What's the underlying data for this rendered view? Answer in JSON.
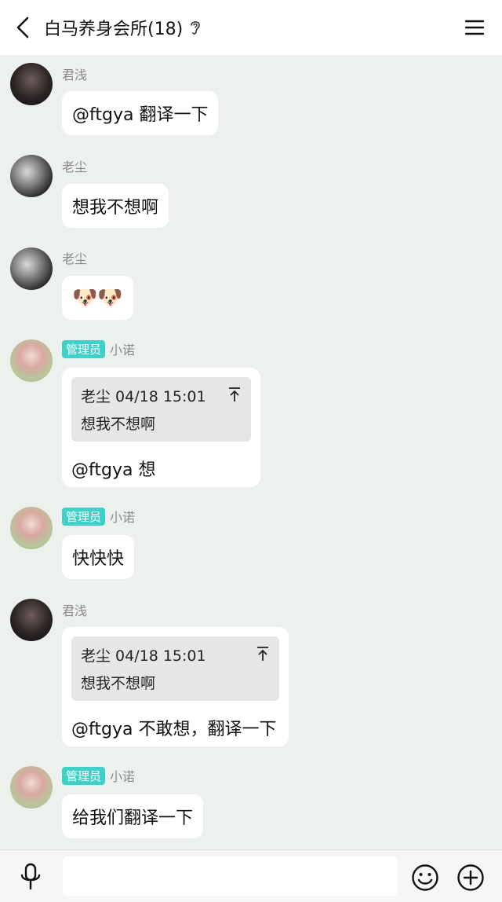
{
  "header": {
    "title": "白马养身会所(18)",
    "icons": [
      "back-icon",
      "ear-icon",
      "menu-icon"
    ]
  },
  "messages": [
    {
      "sender": "君浅",
      "is_admin": false,
      "text": "@ftgya 翻译一下"
    },
    {
      "sender": "老尘",
      "is_admin": false,
      "text": "想我不想啊"
    },
    {
      "sender": "老尘",
      "is_admin": false,
      "text": "🐶🐶"
    },
    {
      "sender": "小诺",
      "is_admin": true,
      "admin_label": "管理员",
      "quote": {
        "author_time": "老尘 04/18 15:01",
        "text": "想我不想啊"
      },
      "text": "@ftgya 想"
    },
    {
      "sender": "小诺",
      "is_admin": true,
      "admin_label": "管理员",
      "text": "快快快"
    },
    {
      "sender": "君浅",
      "is_admin": false,
      "quote": {
        "author_time": "老尘 04/18 15:01",
        "text": "想我不想啊"
      },
      "text": "@ftgya 不敢想，翻译一下"
    },
    {
      "sender": "小诺",
      "is_admin": true,
      "admin_label": "管理员",
      "text": "给我们翻译一下"
    }
  ],
  "composer": {
    "value": "",
    "icons": [
      "microphone-icon",
      "emoji-icon",
      "plus-icon"
    ]
  },
  "colors": {
    "background": "#edf1ee",
    "bubble": "#ffffff",
    "admin_badge": "#3fd1c8",
    "quote_bg": "#e6e6e6"
  }
}
